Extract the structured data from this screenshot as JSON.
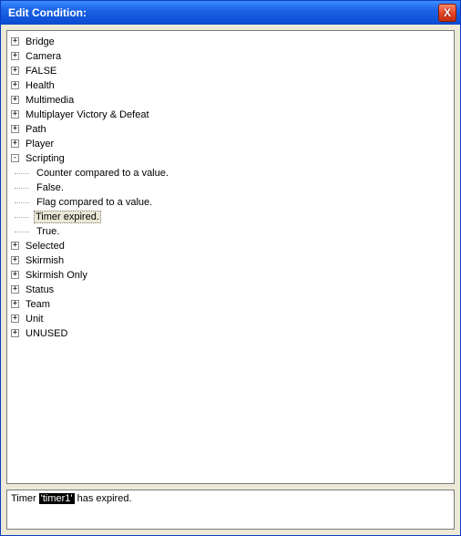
{
  "window": {
    "title": "Edit Condition:"
  },
  "tree": {
    "roots": [
      {
        "label": "Bridge",
        "expanded": false
      },
      {
        "label": "Camera",
        "expanded": false
      },
      {
        "label": "FALSE",
        "expanded": false
      },
      {
        "label": "Health",
        "expanded": false
      },
      {
        "label": "Multimedia",
        "expanded": false
      },
      {
        "label": "Multiplayer Victory & Defeat",
        "expanded": false
      },
      {
        "label": "Path",
        "expanded": false
      },
      {
        "label": "Player",
        "expanded": false
      },
      {
        "label": "Scripting",
        "expanded": true,
        "children": [
          {
            "label": "Counter compared to a value."
          },
          {
            "label": "False."
          },
          {
            "label": "Flag compared to a value."
          },
          {
            "label": "Timer expired.",
            "selected": true
          },
          {
            "label": "True."
          }
        ]
      },
      {
        "label": "Selected",
        "expanded": false
      },
      {
        "label": "Skirmish",
        "expanded": false
      },
      {
        "label": "Skirmish Only",
        "expanded": false
      },
      {
        "label": "Status",
        "expanded": false
      },
      {
        "label": "Team",
        "expanded": false
      },
      {
        "label": "Unit",
        "expanded": false
      },
      {
        "label": "UNUSED",
        "expanded": false
      }
    ]
  },
  "description": {
    "prefix": "Timer ",
    "param": "'timer1'",
    "suffix": " has expired."
  },
  "glyphs": {
    "plus": "+",
    "minus": "-",
    "close": "X"
  }
}
